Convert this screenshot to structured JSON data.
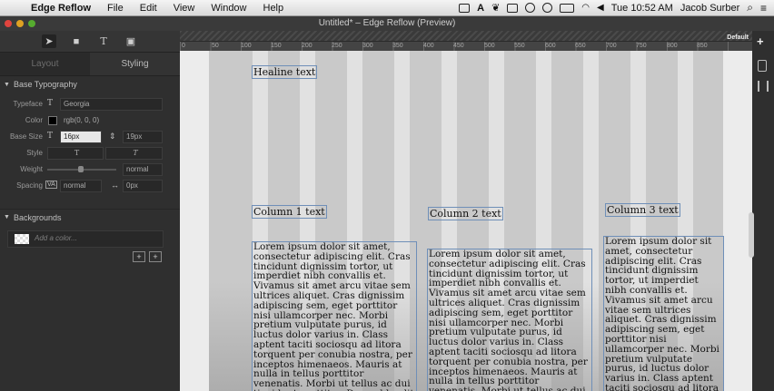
{
  "menubar": {
    "app_name": "Edge Reflow",
    "menus": [
      "File",
      "Edit",
      "View",
      "Window",
      "Help"
    ],
    "clock": "Tue 10:52 AM",
    "user": "Jacob Surber"
  },
  "window": {
    "title": "Untitled* – Edge Reflow (Preview)"
  },
  "panel": {
    "tabs": {
      "layout": "Layout",
      "styling": "Styling"
    },
    "base_typography": {
      "header": "Base Typography",
      "typeface_label": "Typeface",
      "typeface_value": "Georgia",
      "color_label": "Color",
      "color_value": "rgb(0, 0, 0)",
      "base_size_label": "Base Size",
      "base_size_value": "16px",
      "line_height_value": "19px",
      "style_label": "Style",
      "weight_label": "Weight",
      "weight_value": "normal",
      "spacing_label": "Spacing",
      "letter_spacing_value": "normal",
      "word_spacing_value": "0px"
    },
    "backgrounds": {
      "header": "Backgrounds",
      "add_color_placeholder": "Add a color..."
    }
  },
  "ruler": {
    "labels": [
      "0",
      "50",
      "100",
      "150",
      "200",
      "250",
      "300",
      "350",
      "400",
      "450",
      "500",
      "550",
      "600",
      "650",
      "700",
      "750",
      "800",
      "850"
    ]
  },
  "breakpoint_label": "Default",
  "canvas": {
    "headline": "Healine text",
    "columns": [
      {
        "heading": "Column 1 text"
      },
      {
        "heading": "Column 2 text"
      },
      {
        "heading": "Column 3 text"
      }
    ],
    "lorem": "Lorem ipsum dolor sit amet, consectetur adipiscing elit. Cras tincidunt dignissim tortor, ut imperdiet nibh convallis et. Vivamus sit amet arcu vitae sem ultrices aliquet. Cras dignissim adipiscing sem, eget porttitor nisi ullamcorper nec. Morbi pretium vulputate purus, id luctus dolor varius in. Class aptent taciti sociosqu ad litora torquent per conubia nostra, per inceptos himenaeos. Mauris at nulla in tellus porttitor venenatis. Morbi ut tellus ac dui tincidunt porttitor. Donec blandit sollicitudin pretium."
  },
  "colors": {
    "selection_outline": "#6f8fb8",
    "page_bg": "#c9c9c9",
    "panel_bg": "#2f2f2f"
  }
}
